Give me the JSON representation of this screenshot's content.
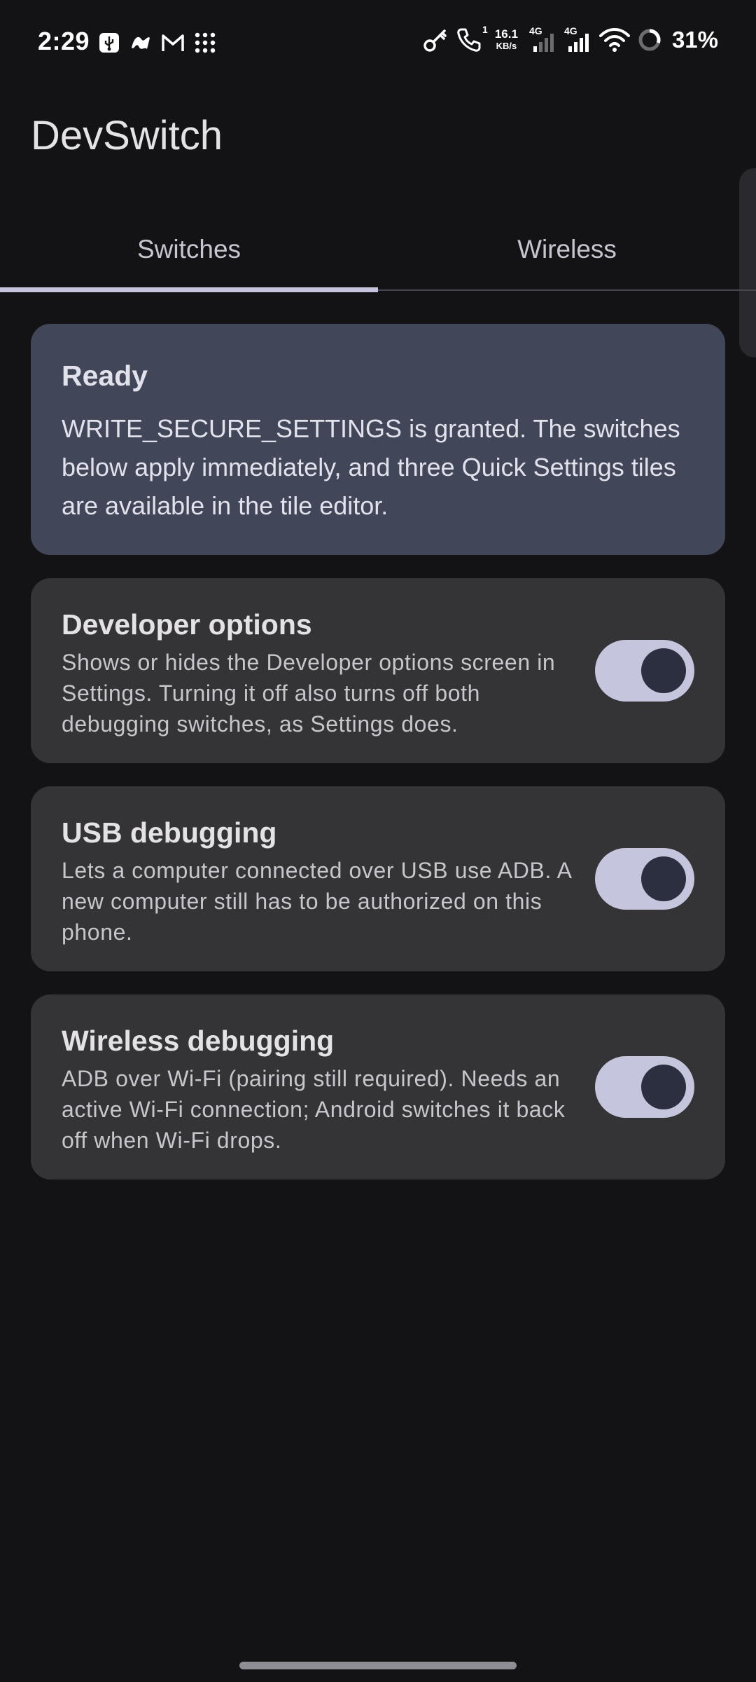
{
  "status_bar": {
    "time": "2:29",
    "net_speed_value": "16.1",
    "net_speed_unit": "KB/s",
    "sim1_tag": "4G",
    "sim2_tag": "4G",
    "call_sim_tag": "1",
    "battery_percent": "31%"
  },
  "app": {
    "title": "DevSwitch"
  },
  "tabs": [
    {
      "label": "Switches",
      "selected": true
    },
    {
      "label": "Wireless",
      "selected": false
    }
  ],
  "status_card": {
    "title": "Ready",
    "body": "WRITE_SECURE_SETTINGS is granted. The switches below apply immediately, and three Quick Settings tiles are available in the tile editor."
  },
  "switches": [
    {
      "title": "Developer options",
      "description": "Shows or hides the Developer options screen in Settings. Turning it off also turns off both debugging switches, as Settings does.",
      "checked": true
    },
    {
      "title": "USB debugging",
      "description": "Lets a computer connected over USB use ADB. A new computer still has to be authorized on this phone.",
      "checked": true
    },
    {
      "title": "Wireless debugging",
      "description": "ADB over Wi-Fi (pairing still required). Needs an active Wi-Fi connection; Android switches it back off when Wi-Fi drops.",
      "checked": true
    }
  ],
  "colors": {
    "background": "#131315",
    "status_card": "#424659",
    "switch_card": "#343437",
    "accent": "#c5c6dd",
    "toggle_thumb": "#2c2f40"
  }
}
